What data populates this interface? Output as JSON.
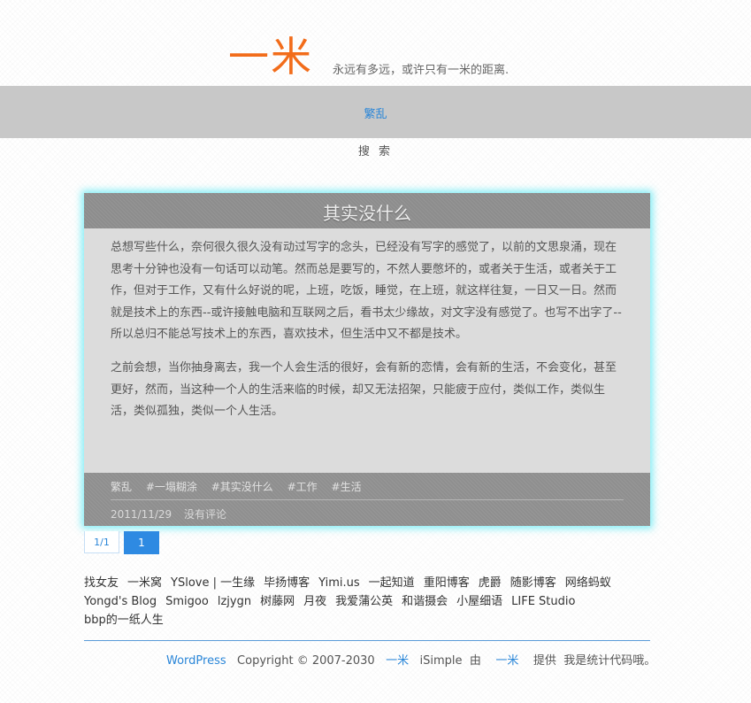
{
  "site": {
    "logo": "一米",
    "tagline": "永远有多远，或许只有一米的距离."
  },
  "nav": {
    "items": [
      {
        "label": "繁乱"
      }
    ],
    "search_label": "搜 索"
  },
  "post": {
    "title": "其实没什么",
    "paragraphs": [
      "总想写些什么，奈何很久很久没有动过写字的念头，已经没有写字的感觉了，以前的文思泉涌，现在思考十分钟也没有一句话可以动笔。然而总是要写的，不然人要憋坏的，或者关于生活，或者关于工作，但对于工作，又有什么好说的呢，上班，吃饭，睡觉，在上班，就这样往复，一日又一日。然而就是技术上的东西--或许接触电脑和互联网之后，看书太少缘故，对文字没有感觉了。也写不出字了--所以总归不能总写技术上的东西，喜欢技术，但生活中又不都是技术。",
      "之前会想，当你抽身离去，我一个人会生活的很好，会有新的恋情，会有新的生活，不会变化，甚至更好，然而，当这种一个人的生活来临的时候，却又无法招架，只能疲于应付，类似工作，类似生活，类似孤独，类似一个人生活。"
    ],
    "category": "繁乱",
    "tags": [
      "#一塌糊涂",
      "#其实没什么",
      "#工作",
      "#生活"
    ],
    "date": "2011/11/29",
    "comments": "没有评论"
  },
  "pager": {
    "info": "1/1",
    "current": "1"
  },
  "friend_links": [
    "找女友",
    "一米窝",
    "YSlove | 一生缘",
    "毕扬博客",
    "Yimi.us",
    "一起知道",
    "重阳博客",
    "虎爵",
    "随影博客",
    "网络蚂蚁",
    "Yongd's Blog",
    "Smigoo",
    "lzjygn",
    "树藤网",
    "月夜",
    "我爱蒲公英",
    "和谐摄会",
    "小屋细语",
    "LIFE Studio",
    "bbp的一纸人生"
  ],
  "footer": {
    "wordpress": "WordPress",
    "copyright": "Copyright © 2007-2030",
    "site_link": "一米",
    "theme": "iSimple",
    "by": "由",
    "author_link": "一米",
    "provided": "提供",
    "stats": "我是统计代码哦。"
  },
  "colors": {
    "logo": "#f26c1a",
    "link": "#2a86d8",
    "nav_bg": "#c8c8c8",
    "post_glow": "#6eebf5",
    "pager_active": "#2e8ae2"
  }
}
